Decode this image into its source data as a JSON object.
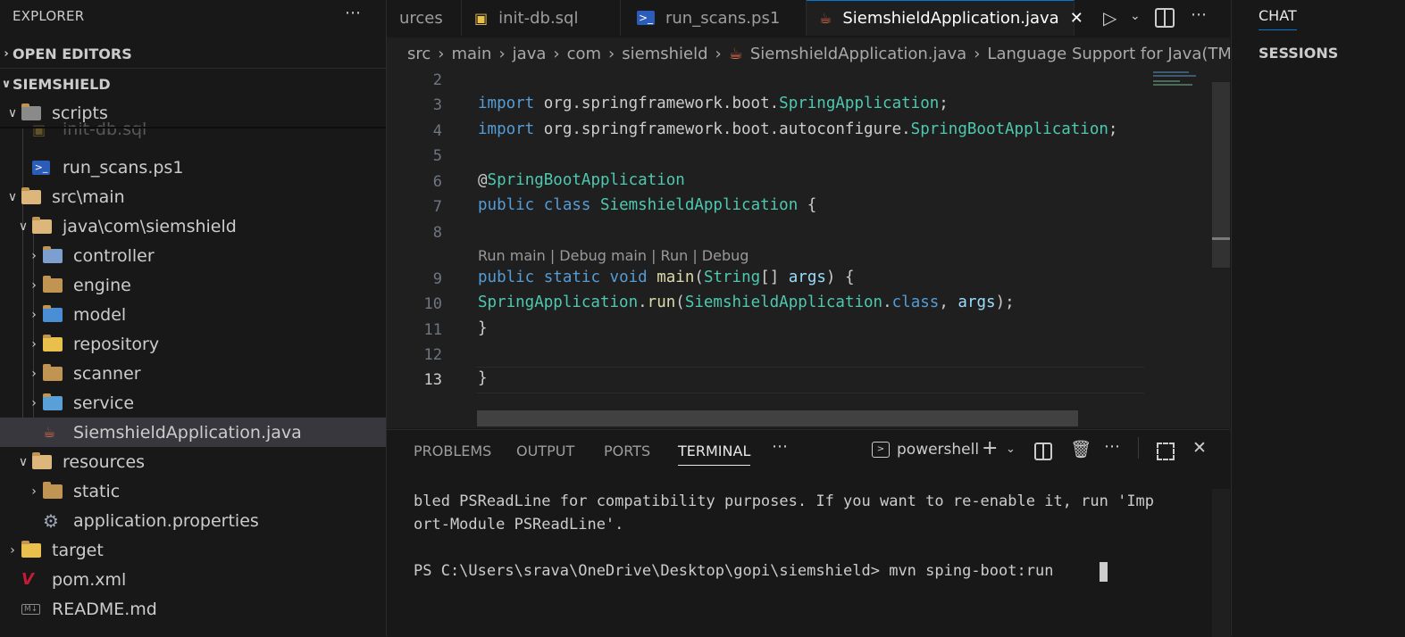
{
  "explorer": {
    "title": "EXPLORER",
    "more": "⋯",
    "open_editors": "OPEN EDITORS",
    "project": "SIEMSHIELD",
    "items": [
      {
        "label": "scripts",
        "depth": 0,
        "twisty": "∨",
        "icon": "scripts-folder-icon"
      },
      {
        "label": "init-db.sql",
        "depth": 1,
        "twisty": "",
        "icon": "database-icon"
      },
      {
        "label": "run_scans.ps1",
        "depth": 1,
        "twisty": "",
        "icon": "powershell-icon"
      },
      {
        "label": "src\\main",
        "depth": 0,
        "twisty": "∨",
        "icon": "folder-open-icon"
      },
      {
        "label": "java\\com\\siemshield",
        "depth": 1,
        "twisty": "∨",
        "icon": "folder-open-icon"
      },
      {
        "label": "controller",
        "depth": 2,
        "twisty": "›",
        "icon": "controller-folder-icon"
      },
      {
        "label": "engine",
        "depth": 2,
        "twisty": "›",
        "icon": "folder-icon"
      },
      {
        "label": "model",
        "depth": 2,
        "twisty": "›",
        "icon": "model-folder-icon"
      },
      {
        "label": "repository",
        "depth": 2,
        "twisty": "›",
        "icon": "repository-folder-icon"
      },
      {
        "label": "scanner",
        "depth": 2,
        "twisty": "›",
        "icon": "folder-icon"
      },
      {
        "label": "service",
        "depth": 2,
        "twisty": "›",
        "icon": "service-folder-icon"
      },
      {
        "label": "SiemshieldApplication.java",
        "depth": 2,
        "twisty": "",
        "icon": "java-icon",
        "selected": true
      },
      {
        "label": "resources",
        "depth": 1,
        "twisty": "∨",
        "icon": "folder-open-icon"
      },
      {
        "label": "static",
        "depth": 2,
        "twisty": "›",
        "icon": "folder-icon"
      },
      {
        "label": "application.properties",
        "depth": 2,
        "twisty": "",
        "icon": "gear-icon"
      },
      {
        "label": "target",
        "depth": 0,
        "twisty": "›",
        "icon": "target-folder-icon"
      },
      {
        "label": "pom.xml",
        "depth": 0,
        "twisty": "",
        "icon": "maven-icon"
      },
      {
        "label": "README.md",
        "depth": 0,
        "twisty": "",
        "icon": "markdown-icon"
      }
    ]
  },
  "tabs": [
    {
      "label": "urces",
      "icon": ""
    },
    {
      "label": "init-db.sql",
      "icon": "database-icon"
    },
    {
      "label": "run_scans.ps1",
      "icon": "powershell-icon"
    },
    {
      "label": "SiemshieldApplication.java",
      "icon": "java-icon",
      "active": true,
      "close": "✕"
    }
  ],
  "toolbar": {
    "more": "⋯"
  },
  "breadcrumb": [
    "src",
    "main",
    "java",
    "com",
    "siemshield",
    "SiemshieldApplication.java",
    "Language Support for Java(TM) by"
  ],
  "editor": {
    "line_numbers": [
      "2",
      "3",
      "4",
      "5",
      "6",
      "7",
      "8",
      "9",
      "10",
      "11",
      "12",
      "13"
    ],
    "code_lens": "Run main | Debug main | Run | Debug",
    "lines": [
      "",
      "import org.springframework.boot.SpringApplication;",
      "import org.springframework.boot.autoconfigure.SpringBootApplication;",
      "",
      "@SpringBootApplication",
      "public class SiemshieldApplication {",
      "",
      "public static void main(String[] args) {",
      "SpringApplication.run(SiemshieldApplication.class, args);",
      "}",
      "",
      "}"
    ]
  },
  "panel": {
    "tabs": [
      "PROBLEMS",
      "OUTPUT",
      "PORTS",
      "TERMINAL"
    ],
    "active_tab": "TERMINAL",
    "more": "⋯",
    "shell": "powershell",
    "terminal_lines": [
      "bled PSReadLine for compatibility purposes. If you want to re-enable it, run 'Imp",
      "ort-Module PSReadLine'.",
      "",
      "PS C:\\Users\\srava\\OneDrive\\Desktop\\gopi\\siemshield> mvn sping-boot:run"
    ]
  },
  "right_pane": {
    "title": "CHAT",
    "section": "SESSIONS"
  },
  "colors": {
    "accent": "#0078d4",
    "keyword": "#569cd6",
    "type": "#4ec9b0",
    "function": "#dcdcaa",
    "param": "#9cdcfe",
    "folder": "#c09553"
  }
}
